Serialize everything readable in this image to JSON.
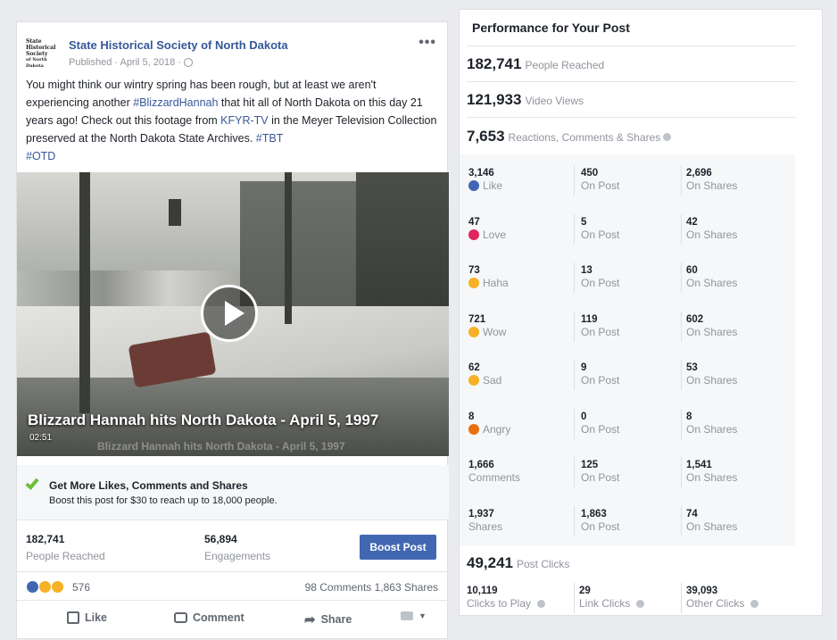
{
  "post": {
    "page_name": "State Historical Society of North Dakota",
    "logo_lines": [
      "State",
      "Historical",
      "Society",
      "of North Dakota"
    ],
    "published": "Published · April 5, 2018 ·",
    "body_1": "You might think our wintry spring has been rough, but at least we aren't experiencing another ",
    "hashtag_1": "#BlizzardHannah",
    "body_2": " that hit all of North Dakota on this day 21 years ago! Check out this footage from ",
    "link_1": "KFYR-TV",
    "body_3": " in the Meyer Television Collection preserved at the North Dakota State Archives. ",
    "hashtag_2": "#TBT",
    "hashtag_3": "#OTD",
    "video_title": "Blizzard Hannah hits North Dakota - April 5, 1997",
    "video_time": "02:51",
    "video_ghost": "Blizzard Hannah hits North Dakota - April 5, 1997",
    "promo_title": "Get More Likes, Comments and Shares",
    "promo_sub": "Boost this post for $30 to reach up to 18,000 people.",
    "reached_num": "182,741",
    "reached_lbl": "People Reached",
    "engage_num": "56,894",
    "engage_lbl": "Engagements",
    "boost_label": "Boost Post",
    "reactions_count": "576",
    "comments_shares": "98 Comments  1,863 Shares",
    "like_label": "Like",
    "comment_label": "Comment",
    "share_label": "Share"
  },
  "perf": {
    "title": "Performance for Your Post",
    "reached_num": "182,741",
    "reached_lbl": "People Reached",
    "views_num": "121,933",
    "views_lbl": "Video Views",
    "rcs_num": "7,653",
    "rcs_lbl": "Reactions, Comments & Shares",
    "rows": [
      {
        "a": "3,146",
        "al": "Like",
        "b": "450",
        "bl": "On Post",
        "c": "2,696",
        "cl": "On Shares",
        "icon": "like-icon",
        "color": "#4267b2"
      },
      {
        "a": "47",
        "al": "Love",
        "b": "5",
        "bl": "On Post",
        "c": "42",
        "cl": "On Shares",
        "icon": "love-icon",
        "color": "#e0245e"
      },
      {
        "a": "73",
        "al": "Haha",
        "b": "13",
        "bl": "On Post",
        "c": "60",
        "cl": "On Shares",
        "icon": "haha-icon",
        "color": "#f7b125"
      },
      {
        "a": "721",
        "al": "Wow",
        "b": "119",
        "bl": "On Post",
        "c": "602",
        "cl": "On Shares",
        "icon": "wow-icon",
        "color": "#f7b125"
      },
      {
        "a": "62",
        "al": "Sad",
        "b": "9",
        "bl": "On Post",
        "c": "53",
        "cl": "On Shares",
        "icon": "sad-icon",
        "color": "#f7b125"
      },
      {
        "a": "8",
        "al": "Angry",
        "b": "0",
        "bl": "On Post",
        "c": "8",
        "cl": "On Shares",
        "icon": "angry-icon",
        "color": "#e9710f"
      },
      {
        "a": "1,666",
        "al": "Comments",
        "b": "125",
        "bl": "On Post",
        "c": "1,541",
        "cl": "On Shares",
        "icon": "",
        "color": ""
      },
      {
        "a": "1,937",
        "al": "Shares",
        "b": "1,863",
        "bl": "On Post",
        "c": "74",
        "cl": "On Shares",
        "icon": "",
        "color": ""
      }
    ],
    "clicks_num": "49,241",
    "clicks_lbl": "Post Clicks",
    "play_num": "10,119",
    "play_lbl": "Clicks to Play",
    "link_num": "29",
    "link_lbl": "Link Clicks",
    "other_num": "39,093",
    "other_lbl": "Other Clicks"
  }
}
